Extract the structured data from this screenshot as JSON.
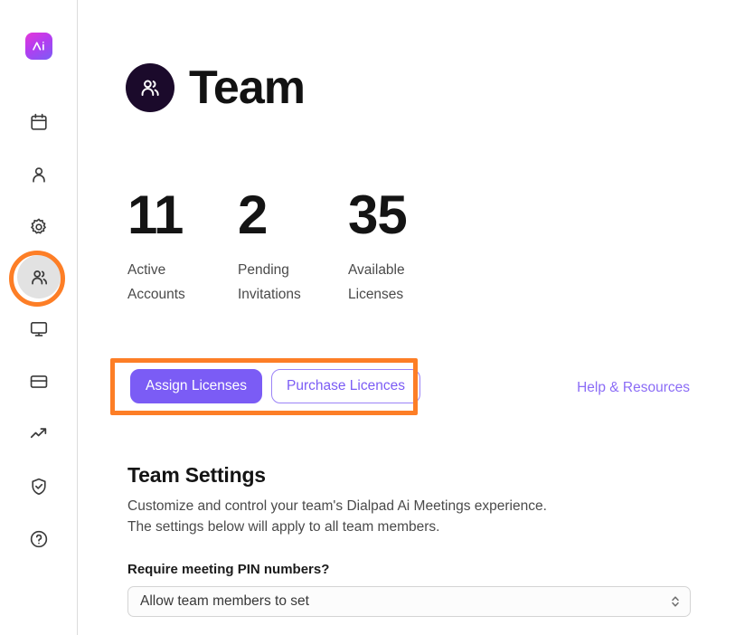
{
  "sidebar": {
    "logo": {
      "name": "dialpad-ai-logo",
      "alt": "Dialpad Ai"
    },
    "items": [
      {
        "icon": "calendar-icon",
        "label": "Meetings",
        "active": false
      },
      {
        "icon": "person-icon",
        "label": "Account",
        "active": false
      },
      {
        "icon": "gear-icon",
        "label": "Settings",
        "active": false
      },
      {
        "icon": "people-icon",
        "label": "Team",
        "active": true
      },
      {
        "icon": "monitor-icon",
        "label": "Devices",
        "active": false
      },
      {
        "icon": "credit-card-icon",
        "label": "Billing",
        "active": false
      },
      {
        "icon": "trending-up-icon",
        "label": "Analytics",
        "active": false
      },
      {
        "icon": "shield-check-icon",
        "label": "Security",
        "active": false
      },
      {
        "icon": "help-circle-icon",
        "label": "Help",
        "active": false
      }
    ]
  },
  "header": {
    "avatar_icon": "people-icon",
    "title": "Team"
  },
  "stats": [
    {
      "value": "11",
      "label": "Active\nAccounts",
      "label_line1": "Active",
      "label_line2": "Accounts"
    },
    {
      "value": "2",
      "label": "Pending\nInvitations",
      "label_line1": "Pending",
      "label_line2": "Invitations"
    },
    {
      "value": "35",
      "label": "Available\nLicenses",
      "label_line1": "Available",
      "label_line2": "Licenses"
    }
  ],
  "actions": {
    "assign_label": "Assign Licenses",
    "purchase_label": "Purchase Licences",
    "help_label": "Help & Resources"
  },
  "settings": {
    "title": "Team Settings",
    "description_line1": "Customize and control your team's Dialpad Ai Meetings experience.",
    "description_line2": "The settings below will apply to all team members.",
    "pin_field": {
      "label": "Require meeting PIN numbers?",
      "value": "Allow team members to set",
      "options": [
        "Allow team members to set"
      ]
    }
  },
  "annotations": {
    "sidebar_ring": "orange-highlight-ring",
    "buttons_rect": "orange-highlight-rectangle"
  },
  "colors": {
    "accent_purple": "#7b5cf5",
    "highlight_orange": "#fd7e26",
    "avatar_dark": "#1b0a2b",
    "active_nav_bg": "#e2e2e2"
  }
}
